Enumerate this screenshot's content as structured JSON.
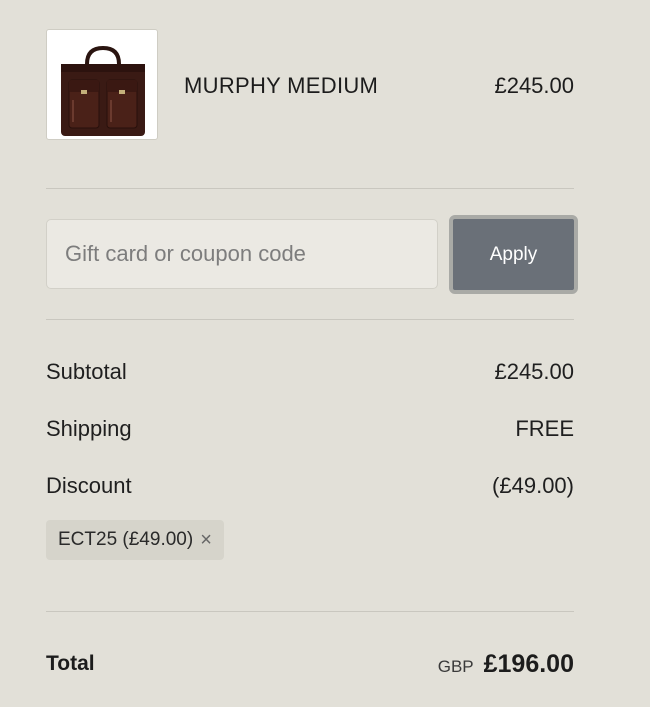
{
  "product": {
    "name": "MURPHY MEDIUM",
    "price": "£245.00",
    "image_alt": "bag-thumbnail"
  },
  "coupon": {
    "placeholder": "Gift card or coupon code",
    "value": "",
    "apply_label": "Apply"
  },
  "summary": {
    "subtotal_label": "Subtotal",
    "subtotal_value": "£245.00",
    "shipping_label": "Shipping",
    "shipping_value": "FREE",
    "discount_label": "Discount",
    "discount_value": "(£49.00)",
    "discount_tag": "ECT25 (£49.00)",
    "discount_remove": "×"
  },
  "total": {
    "label": "Total",
    "currency": "GBP",
    "amount": "£196.00"
  },
  "colors": {
    "background": "#e2e0d8",
    "apply_button": "#6a7078",
    "tag_background": "#d6d4cb"
  }
}
